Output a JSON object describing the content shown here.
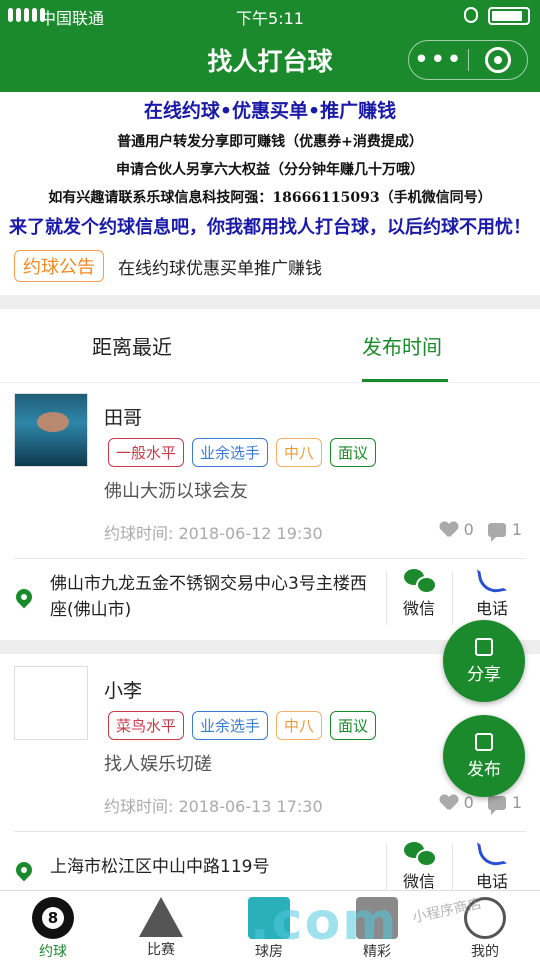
{
  "status": {
    "carrier": "中国联通",
    "time": "下午5:11"
  },
  "nav": {
    "title": "找人打台球"
  },
  "banner": {
    "line1": "在线约球•优惠买单•推广赚钱",
    "line2": "普通用户转发分享即可赚钱（优惠券+消费提成）",
    "line3": "申请合伙人另享六大权益（分分钟年赚几十万哦）",
    "line4": "如有兴趣请联系乐球信息科技阿强：18666115093（手机微信同号）",
    "line5": "来了就发个约球信息吧，你我都用找人打台球，以后约球不用忧！"
  },
  "notice": {
    "tag": "约球公告",
    "text": "在线约球优惠买单推广赚钱"
  },
  "tabs": {
    "nearest": "距离最近",
    "latest": "发布时间"
  },
  "posts": [
    {
      "name": "田哥",
      "tags": [
        "一般水平",
        "业余选手",
        "中八",
        "面议"
      ],
      "desc": "佛山大沥以球会友",
      "time": "约球时间: 2018-06-12 19:30",
      "likes": "0",
      "comments": "1",
      "address": "佛山市九龙五金不锈钢交易中心3号主楼西座(佛山市)",
      "wechat": "微信",
      "phone": "电话"
    },
    {
      "name": "小李",
      "tags": [
        "菜鸟水平",
        "业余选手",
        "中八",
        "面议"
      ],
      "desc": "找人娱乐切磋",
      "time": "约球时间: 2018-06-13 17:30",
      "likes": "0",
      "comments": "1",
      "address": "上海市松江区中山中路119号",
      "wechat": "微信",
      "phone": "电话"
    }
  ],
  "fab": {
    "share": "分享",
    "publish": "发布"
  },
  "tabbar": {
    "yueqiu": "约球",
    "bisai": "比赛",
    "qiufang": "球房",
    "jingcai": "精彩",
    "wode": "我的"
  },
  "watermark": {
    "text": ".com",
    "small": "小程序商店"
  },
  "colors": {
    "brand": "#1b8a2c",
    "banner_blue": "#1a1aa8"
  }
}
